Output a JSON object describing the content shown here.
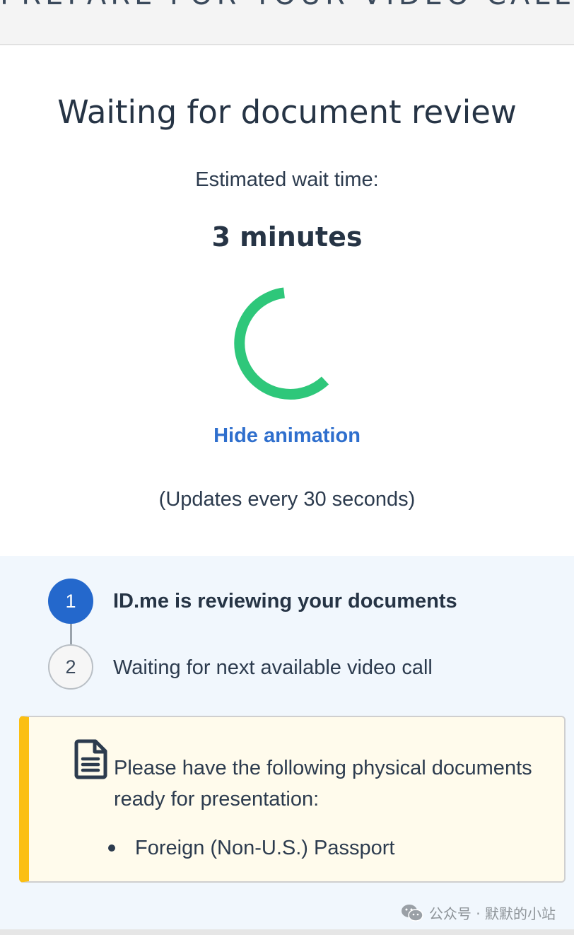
{
  "header": {
    "title": "PREPARE FOR YOUR VIDEO CALL"
  },
  "status": {
    "title": "Waiting for document review",
    "wait_label": "Estimated wait time:",
    "wait_value": "3 minutes",
    "hide_animation_label": "Hide animation",
    "updates_note": "(Updates every 30 seconds)"
  },
  "steps": [
    {
      "number": "1",
      "label": "ID.me is reviewing your documents",
      "state": "active"
    },
    {
      "number": "2",
      "label": "Waiting for next available video call",
      "state": "pending"
    }
  ],
  "notice": {
    "text": "Please have the following physical documents ready for presentation:",
    "items": [
      "Foreign (Non-U.S.) Passport"
    ],
    "icon": "document-icon"
  },
  "watermark": {
    "text": "公众号 · 默默的小站",
    "icon": "wechat-icon"
  },
  "colors": {
    "spinner": "#2ec77a",
    "link": "#2f6fcd",
    "step_active": "#2468cc",
    "notice_accent": "#fbbf12",
    "notice_bg": "#fffbec",
    "steps_bg": "#f1f7fd"
  }
}
